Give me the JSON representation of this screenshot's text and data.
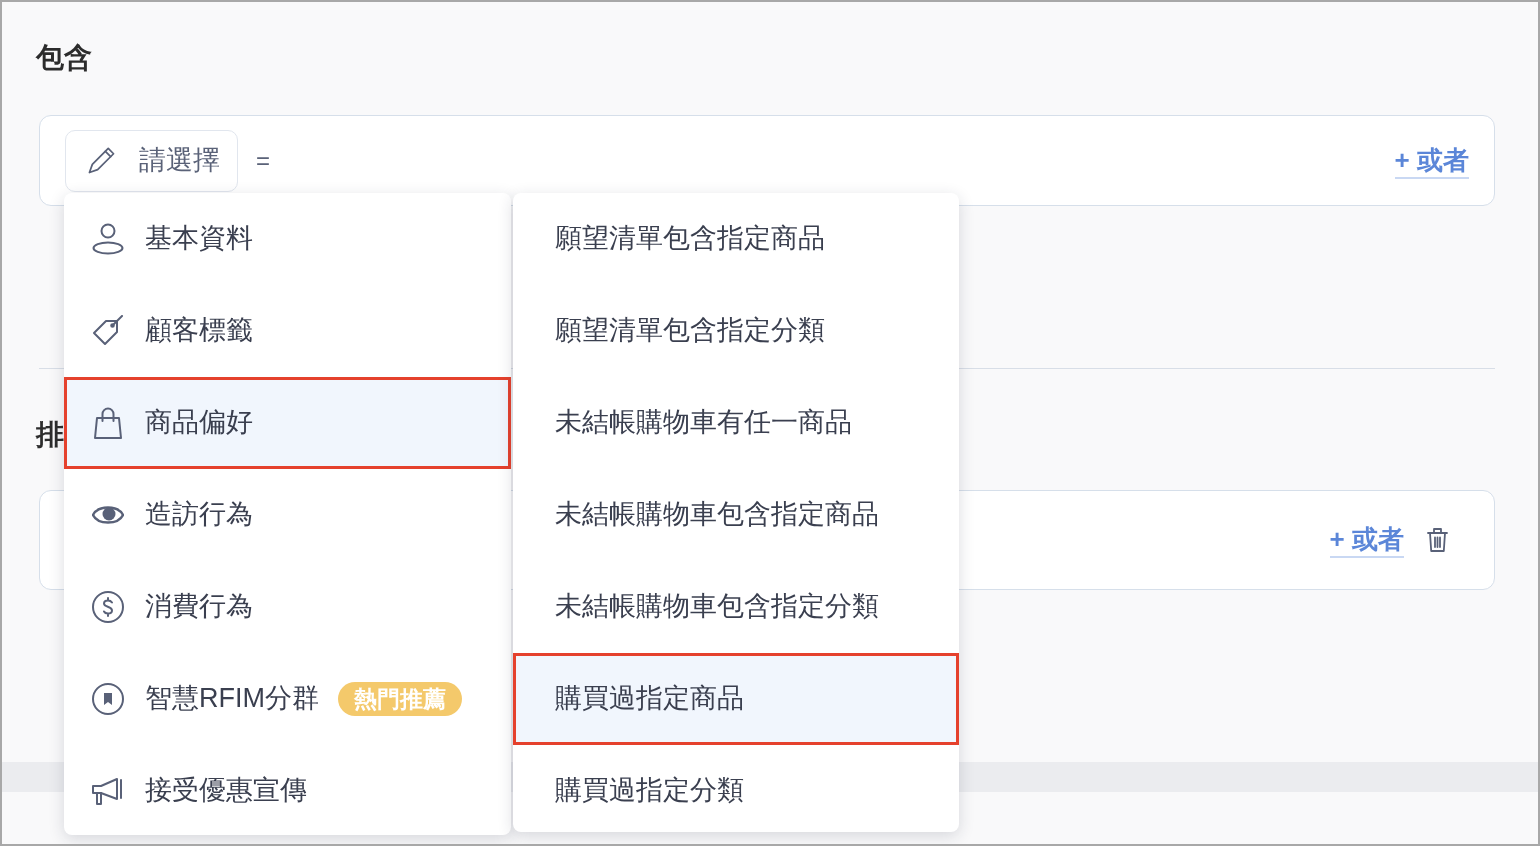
{
  "sections": [
    {
      "title": "包含",
      "condition": {
        "picker": {
          "label": "請選擇",
          "expanded": true,
          "categories": [
            {
              "label": "基本資料",
              "selected": false
            },
            {
              "label": "顧客標籤",
              "selected": false
            },
            {
              "label": "商品偏好",
              "selected": true
            },
            {
              "label": "造訪行為",
              "selected": false
            },
            {
              "label": "消費行為",
              "selected": false
            },
            {
              "label": "智慧RFIM分群",
              "selected": false,
              "badge": "熱門推薦"
            },
            {
              "label": "接受優惠宣傳",
              "selected": false
            }
          ],
          "conditions": [
            {
              "label": "願望清單包含指定商品",
              "selected": false
            },
            {
              "label": "願望清單包含指定分類",
              "selected": false
            },
            {
              "label": "未結帳購物車有任一商品",
              "selected": false
            },
            {
              "label": "未結帳購物車包含指定商品",
              "selected": false
            },
            {
              "label": "未結帳購物車包含指定分類",
              "selected": false
            },
            {
              "label": "購買過指定商品",
              "selected": true
            },
            {
              "label": "購買過指定分類",
              "selected": false
            }
          ]
        },
        "operator": "=",
        "or_link": "+ 或者",
        "deletable": false
      }
    },
    {
      "title": "排",
      "condition": {
        "or_link": "+ 或者",
        "deletable": true
      }
    }
  ]
}
